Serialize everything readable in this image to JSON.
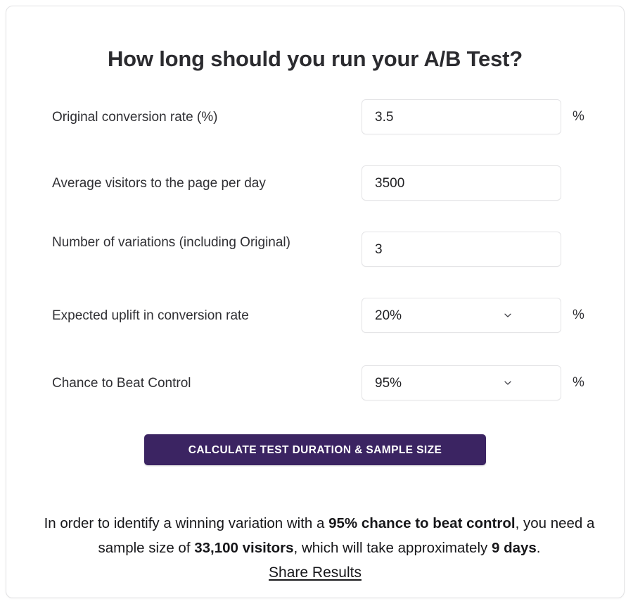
{
  "page": {
    "title": "How long should you run your A/B Test?",
    "accent_color": "#3b2462",
    "card_border_color": "#e2e2e4",
    "text_color": "#2f2f33"
  },
  "form": {
    "fields": [
      {
        "label": "Original conversion rate (%)",
        "value": "3.5",
        "type": "text",
        "suffix": "%",
        "has_chevron": false
      },
      {
        "label": "Average visitors to the page per day",
        "value": "3500",
        "type": "text",
        "suffix": "",
        "has_chevron": false
      },
      {
        "label": "Number of variations (including Original)",
        "value": "3",
        "type": "text",
        "suffix": "",
        "has_chevron": false
      },
      {
        "label": "Expected uplift in conversion rate",
        "value": "20%",
        "type": "select",
        "suffix": "%",
        "has_chevron": true,
        "icon": "chevron-down-icon"
      },
      {
        "label": "Chance to Beat Control",
        "value": "95%",
        "type": "select",
        "suffix": "%",
        "has_chevron": true,
        "icon": "chevron-down-icon"
      }
    ]
  },
  "actions": {
    "calculate_label": "CALCULATE TEST DURATION & SAMPLE SIZE",
    "share_label": "Share Results"
  },
  "result": {
    "part_1": "In order to identify a winning variation with a ",
    "highlight_1": "95% chance to beat control",
    "part_2": ", you need a sample size of ",
    "highlight_2": "33,100 visitors",
    "part_3": ", which will take approximately ",
    "highlight_3": "9 days",
    "part_4": "."
  }
}
